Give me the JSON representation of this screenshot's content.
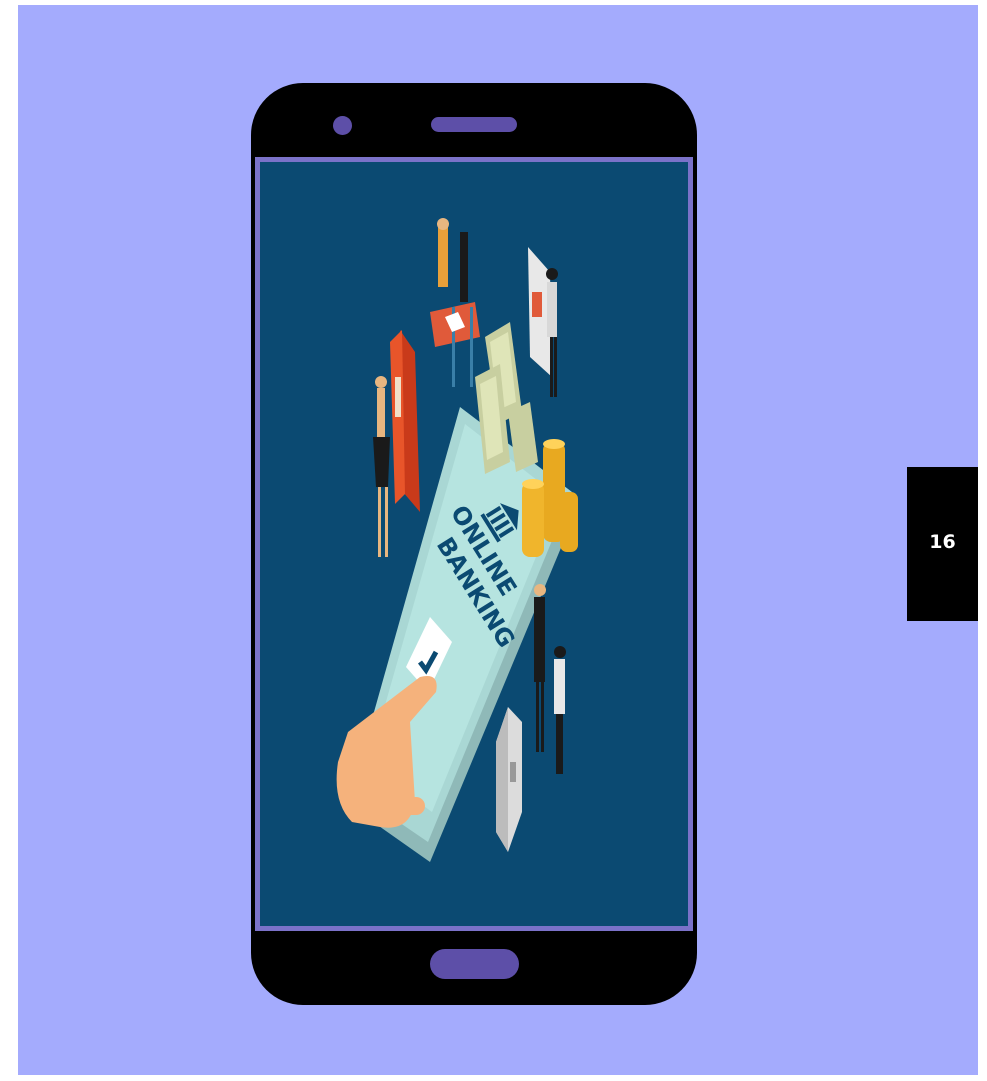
{
  "illustration": {
    "label_line1": "ONLINE",
    "label_line2": "BANKING",
    "icons": [
      "bank-icon",
      "checkmark-icon",
      "atm-icon",
      "safe-icon",
      "coin-icon",
      "banknote-icon",
      "pointing-hand-icon"
    ]
  },
  "page": {
    "number": "16"
  },
  "colors": {
    "background": "#a4abfd",
    "phone_body": "#000000",
    "phone_accent": "#5d4fa8",
    "screen_bezel": "#7b72c9",
    "screen_bg": "#0b4a72",
    "page_tab": "#000000"
  }
}
